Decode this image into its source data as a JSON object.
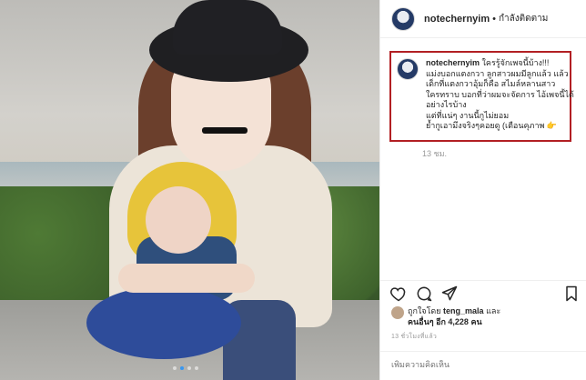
{
  "post": {
    "username": "notechernyim",
    "separator": "•",
    "follow_status": "กำลังติดตาม",
    "caption_username": "notechernyim",
    "caption_lines": [
      "ใครรู้จักเพจนี้บ้าง!!!",
      "แม่งบอกแตงกวา ลูกสาวผมมีลูกแล้ว แล้ว",
      "เด็กที่แตงกวาอุ้มก็คือ สไมล์หลานสาว",
      "ใครทราบ บอกที่ว่าผมจะจัดการ ไอ้เพจนี้ได้",
      "อย่างไรบ้าง",
      "แต่ที่แน่ๆ งานนี้กูไม่ยอม",
      "ย้ำกูเอามึงจริงๆคอยดู (เตือนคุภาพ 👉"
    ],
    "caption_time": "13 ชม.",
    "likes_prefix": "ถูกใจโดย",
    "likes_user": "teng_mala",
    "likes_and": "และ",
    "likes_others": "คนอื่นๆ อีก 4,228 คน",
    "post_time": "13 ชั่วโมงที่แล้ว",
    "comment_placeholder": "เพิ่มความคิดเห็น",
    "carousel_dots": 4,
    "carousel_active": 1
  },
  "icons": {
    "heart": "heart-icon",
    "comment": "comment-icon",
    "share": "share-icon",
    "save": "bookmark-icon"
  },
  "colors": {
    "highlight_box": "#b21f23",
    "carousel_active": "#3897f0"
  }
}
